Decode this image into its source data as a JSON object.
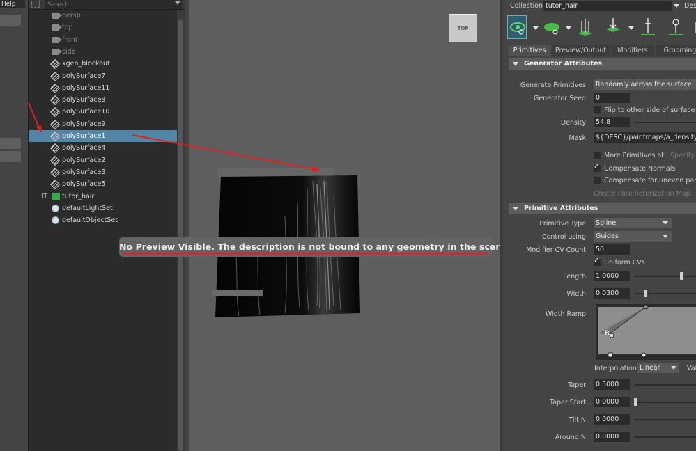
{
  "menu": {
    "help_label": "Help"
  },
  "outliner": {
    "search_placeholder": "Search...",
    "items": [
      {
        "label": "persp",
        "icon": "camera-icon",
        "dim": true
      },
      {
        "label": "top",
        "icon": "camera-icon",
        "dim": true
      },
      {
        "label": "front",
        "icon": "camera-icon",
        "dim": true
      },
      {
        "label": "side",
        "icon": "camera-icon",
        "dim": true
      },
      {
        "label": "xgen_blockout",
        "icon": "mesh-icon"
      },
      {
        "label": "polySurface7",
        "icon": "mesh-icon"
      },
      {
        "label": "polySurface11",
        "icon": "mesh-icon"
      },
      {
        "label": "polySurface8",
        "icon": "mesh-icon"
      },
      {
        "label": "polySurface10",
        "icon": "mesh-icon"
      },
      {
        "label": "polySurface9",
        "icon": "mesh-icon"
      },
      {
        "label": "polySurface1",
        "icon": "mesh-icon",
        "selected": true
      },
      {
        "label": "polySurface4",
        "icon": "mesh-icon"
      },
      {
        "label": "polySurface2",
        "icon": "mesh-icon"
      },
      {
        "label": "polySurface3",
        "icon": "mesh-icon"
      },
      {
        "label": "polySurface5",
        "icon": "mesh-icon"
      },
      {
        "label": "tutor_hair",
        "icon": "xgen-collection-icon",
        "expandable": true
      },
      {
        "label": "defaultLightSet",
        "icon": "set-icon"
      },
      {
        "label": "defaultObjectSet",
        "icon": "set-icon"
      }
    ]
  },
  "viewport": {
    "view_cube_label": "TOP",
    "warning": "No Preview Visible. The description is not bound to any geometry in the scene."
  },
  "xgen": {
    "collection_label": "Collection",
    "collection_value": "tutor_hair",
    "description_label": "Des",
    "tabs": [
      "Primitives",
      "Preview/Output",
      "Modifiers",
      "Grooming"
    ],
    "generator": {
      "section_title": "Generator Attributes",
      "generate_primitives_label": "Generate Primitives",
      "generate_primitives_value": "Randomly across the surface",
      "generator_seed_label": "Generator Seed",
      "generator_seed_value": "0",
      "flip_label": "Flip to other side of surface",
      "density_label": "Density",
      "density_value": "54.8",
      "mask_label": "Mask",
      "mask_value": "${DESC}/paintmaps/a_density",
      "more_primitives_label": "More Primitives at",
      "specify_label": "Specify F",
      "compensate_normals_label": "Compensate Normals",
      "compensate_uneven_label": "Compensate for uneven paran",
      "create_param_map_label": "Create Parameterization Map"
    },
    "primitive": {
      "section_title": "Primitive Attributes",
      "primitive_type_label": "Primitive Type",
      "primitive_type_value": "Spline",
      "control_using_label": "Control using",
      "control_using_value": "Guides",
      "modifier_cv_label": "Modifier CV Count",
      "modifier_cv_value": "50",
      "uniform_cvs_label": "Uniform CVs",
      "length_label": "Length",
      "length_value": "1.0000",
      "length_level": 0.7,
      "width_label": "Width",
      "width_value": "0.0300",
      "width_level": 0.15,
      "width_ramp_label": "Width Ramp",
      "interpolation_label": "Interpolation:",
      "interpolation_value": "Linear",
      "val_label": "Val",
      "taper_label": "Taper",
      "taper_value": "0.5000",
      "taper_start_label": "Taper Start",
      "taper_start_value": "0.0000",
      "tilt_n_label": "Tilt N",
      "tilt_n_value": "0.0000",
      "around_n_label": "Around N",
      "around_n_value": "0.0000"
    }
  },
  "colors": {
    "selection": "#5285a6",
    "annotation_red": "#e02020",
    "xgen_green": "#3aa84a"
  }
}
